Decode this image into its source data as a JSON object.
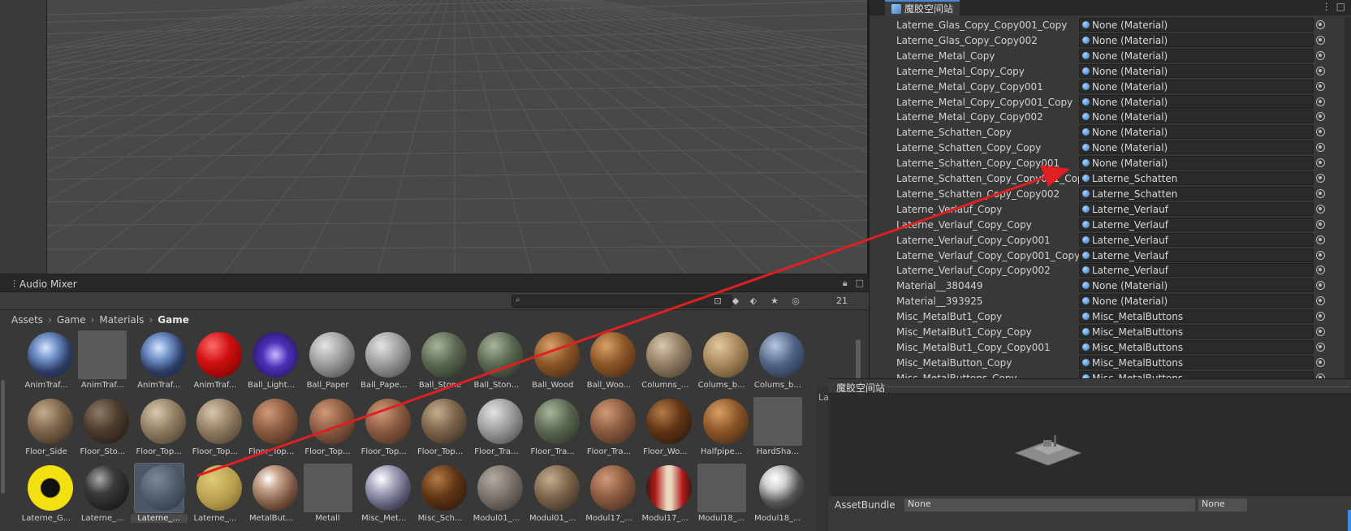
{
  "scene": {},
  "project": {
    "tab_label": "Audio Mixer",
    "search_placeholder": "",
    "hidden_count": "21",
    "breadcrumb": [
      "Assets",
      "Game",
      "Materials",
      "Game"
    ],
    "assets": [
      {
        "label": "AnimTraf...",
        "look": "swirl-blue"
      },
      {
        "label": "AnimTraf...",
        "look": "blank"
      },
      {
        "label": "AnimTraf...",
        "look": "swirl-blue"
      },
      {
        "label": "AnimTraf...",
        "look": "red"
      },
      {
        "label": "Ball_Light...",
        "look": "purple"
      },
      {
        "label": "Ball_Paper",
        "look": "paper"
      },
      {
        "label": "Ball_Pape...",
        "look": "paper"
      },
      {
        "label": "Ball_Stone",
        "look": "stone-green"
      },
      {
        "label": "Ball_Ston...",
        "look": "stone-green"
      },
      {
        "label": "Ball_Wood",
        "look": "wood"
      },
      {
        "label": "Ball_Woo...",
        "look": "wood"
      },
      {
        "label": "Columns_...",
        "look": "beige"
      },
      {
        "label": "Colums_b...",
        "look": "sand"
      },
      {
        "label": "Colums_b...",
        "look": "steel-blue"
      },
      {
        "label": "Floor_Side",
        "look": "brown-stone"
      },
      {
        "label": "Floor_Sto...",
        "look": "dark-stone"
      },
      {
        "label": "Floor_Top...",
        "look": "beige"
      },
      {
        "label": "Floor_Top...",
        "look": "beige"
      },
      {
        "label": "Floor_Top...",
        "look": "brick"
      },
      {
        "label": "Floor_Top...",
        "look": "brick"
      },
      {
        "label": "Floor_Top...",
        "look": "brick"
      },
      {
        "label": "Floor_Top...",
        "look": "brown-stone"
      },
      {
        "label": "Floor_Tra...",
        "look": "paper"
      },
      {
        "label": "Floor_Tra...",
        "look": "stone-green"
      },
      {
        "label": "Floor_Tra...",
        "look": "brick"
      },
      {
        "label": "Floor_Wo...",
        "look": "dark-wood"
      },
      {
        "label": "Halfpipe...",
        "look": "wood"
      },
      {
        "label": "HardSha...",
        "look": "blank"
      },
      {
        "label": "Laterne_G...",
        "look": "yellow-black"
      },
      {
        "label": "Laterne_...",
        "look": "black"
      },
      {
        "label": "Laterne_...",
        "look": "slate",
        "selected": true
      },
      {
        "label": "Laterne_...",
        "look": "gold"
      },
      {
        "label": "MetalBut...",
        "look": "copper"
      },
      {
        "label": "Metall",
        "look": "blank"
      },
      {
        "label": "Misc_Met...",
        "look": "silver"
      },
      {
        "label": "Misc_Sch...",
        "look": "dark-wood"
      },
      {
        "label": "Modul01_...",
        "look": "brick-gray"
      },
      {
        "label": "Modul01_...",
        "look": "brown-stone"
      },
      {
        "label": "Modul17_...",
        "look": "brick"
      },
      {
        "label": "Modul17_...",
        "look": "red-stripe"
      },
      {
        "label": "Modul18_...",
        "look": "blank"
      },
      {
        "label": "Modul18_...",
        "look": "chrome"
      }
    ]
  },
  "inspector": {
    "tab_label": "魔胶空间站",
    "rows": [
      {
        "name": "Laterne_Glas_Copy_Copy001_Copy",
        "value": "None (Material)"
      },
      {
        "name": "Laterne_Glas_Copy_Copy002",
        "value": "None (Material)"
      },
      {
        "name": "Laterne_Metal_Copy",
        "value": "None (Material)"
      },
      {
        "name": "Laterne_Metal_Copy_Copy",
        "value": "None (Material)"
      },
      {
        "name": "Laterne_Metal_Copy_Copy001",
        "value": "None (Material)"
      },
      {
        "name": "Laterne_Metal_Copy_Copy001_Copy",
        "value": "None (Material)"
      },
      {
        "name": "Laterne_Metal_Copy_Copy002",
        "value": "None (Material)"
      },
      {
        "name": "Laterne_Schatten_Copy",
        "value": "None (Material)"
      },
      {
        "name": "Laterne_Schatten_Copy_Copy",
        "value": "None (Material)"
      },
      {
        "name": "Laterne_Schatten_Copy_Copy001",
        "value": "None (Material)"
      },
      {
        "name": "Laterne_Schatten_Copy_Copy001_Copy",
        "value": "Laterne_Schatten"
      },
      {
        "name": "Laterne_Schatten_Copy_Copy002",
        "value": "Laterne_Schatten"
      },
      {
        "name": "Laterne_Verlauf_Copy",
        "value": "Laterne_Verlauf"
      },
      {
        "name": "Laterne_Verlauf_Copy_Copy",
        "value": "Laterne_Verlauf"
      },
      {
        "name": "Laterne_Verlauf_Copy_Copy001",
        "value": "Laterne_Verlauf"
      },
      {
        "name": "Laterne_Verlauf_Copy_Copy001_Copy",
        "value": "Laterne_Verlauf"
      },
      {
        "name": "Laterne_Verlauf_Copy_Copy002",
        "value": "Laterne_Verlauf"
      },
      {
        "name": "Material__380449",
        "value": "None (Material)"
      },
      {
        "name": "Material__393925",
        "value": "None (Material)"
      },
      {
        "name": "Misc_MetalBut1_Copy",
        "value": "Misc_MetalButtons"
      },
      {
        "name": "Misc_MetalBut1_Copy_Copy",
        "value": "Misc_MetalButtons"
      },
      {
        "name": "Misc_MetalBut1_Copy_Copy001",
        "value": "Misc_MetalButtons"
      },
      {
        "name": "Misc_MetalButton_Copy",
        "value": "Misc_MetalButtons"
      },
      {
        "name": "Misc_MetalButtons_Copy",
        "value": "Misc_MetalButtons"
      }
    ]
  },
  "preview": {
    "title": "魔胶空间站",
    "side_label": "La",
    "bundle_label": "AssetBundle",
    "bundle_value": "None",
    "variant_value": "None"
  },
  "colors": {
    "annotation_arrow": "#e02020",
    "accent": "#3d8fe6"
  }
}
